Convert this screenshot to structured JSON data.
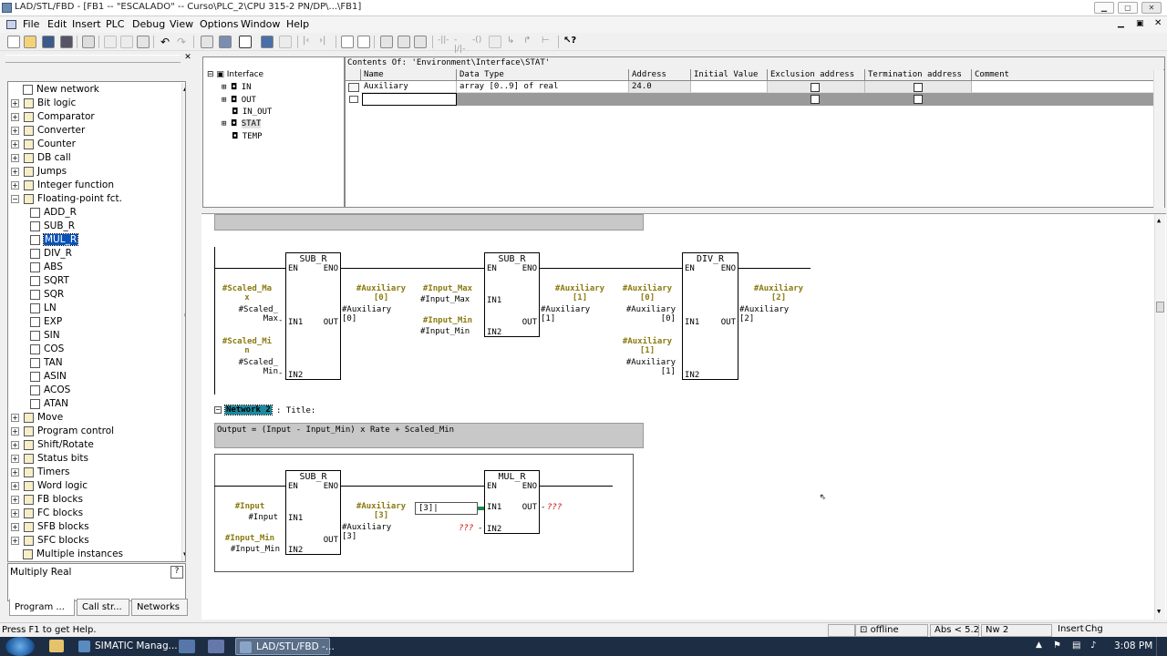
{
  "window": {
    "title": "LAD/STL/FBD  - [FB1 -- \"ESCALADO\" -- Curso\\PLC_2\\CPU 315-2 PN/DP\\...\\FB1]"
  },
  "menu": [
    "File",
    "Edit",
    "Insert",
    "PLC",
    "Debug",
    "View",
    "Options",
    "Window",
    "Help"
  ],
  "catalog": {
    "items": [
      {
        "label": "New network",
        "expander": "",
        "level": 0
      },
      {
        "label": "Bit logic",
        "expander": "+",
        "level": 0
      },
      {
        "label": "Comparator",
        "expander": "+",
        "level": 0
      },
      {
        "label": "Converter",
        "expander": "+",
        "level": 0
      },
      {
        "label": "Counter",
        "expander": "+",
        "level": 0
      },
      {
        "label": "DB call",
        "expander": "+",
        "level": 0
      },
      {
        "label": "Jumps",
        "expander": "+",
        "level": 0
      },
      {
        "label": "Integer function",
        "expander": "+",
        "level": 0
      },
      {
        "label": "Floating-point fct.",
        "expander": "-",
        "level": 0
      },
      {
        "label": "ADD_R",
        "expander": "",
        "level": 1
      },
      {
        "label": "SUB_R",
        "expander": "",
        "level": 1
      },
      {
        "label": "MUL_R",
        "expander": "",
        "level": 1,
        "selected": true
      },
      {
        "label": "DIV_R",
        "expander": "",
        "level": 1
      },
      {
        "label": "ABS",
        "expander": "",
        "level": 1
      },
      {
        "label": "SQRT",
        "expander": "",
        "level": 1
      },
      {
        "label": "SQR",
        "expander": "",
        "level": 1
      },
      {
        "label": "LN",
        "expander": "",
        "level": 1
      },
      {
        "label": "EXP",
        "expander": "",
        "level": 1
      },
      {
        "label": "SIN",
        "expander": "",
        "level": 1
      },
      {
        "label": "COS",
        "expander": "",
        "level": 1
      },
      {
        "label": "TAN",
        "expander": "",
        "level": 1
      },
      {
        "label": "ASIN",
        "expander": "",
        "level": 1
      },
      {
        "label": "ACOS",
        "expander": "",
        "level": 1
      },
      {
        "label": "ATAN",
        "expander": "",
        "level": 1
      },
      {
        "label": "Move",
        "expander": "+",
        "level": 0
      },
      {
        "label": "Program control",
        "expander": "+",
        "level": 0
      },
      {
        "label": "Shift/Rotate",
        "expander": "+",
        "level": 0
      },
      {
        "label": "Status bits",
        "expander": "+",
        "level": 0
      },
      {
        "label": "Timers",
        "expander": "+",
        "level": 0
      },
      {
        "label": "Word logic",
        "expander": "+",
        "level": 0
      },
      {
        "label": "FB blocks",
        "expander": "+",
        "level": 0
      },
      {
        "label": "FC blocks",
        "expander": "+",
        "level": 0
      },
      {
        "label": "SFB blocks",
        "expander": "+",
        "level": 0
      },
      {
        "label": "SFC blocks",
        "expander": "+",
        "level": 0
      },
      {
        "label": "Multiple instances",
        "expander": "",
        "level": 0
      }
    ],
    "description": "Multiply Real",
    "tabs": [
      "Program ...",
      "Call str...",
      "Networks"
    ]
  },
  "interface": {
    "root": "Interface",
    "nodes": [
      "IN",
      "OUT",
      "IN_OUT",
      "STAT",
      "TEMP"
    ],
    "caption": "Contents Of: 'Environment\\Interface\\STAT'",
    "columns": [
      "Name",
      "Data Type",
      "Address",
      "Initial Value",
      "Exclusion address",
      "Termination address",
      "Comment"
    ],
    "rows": [
      {
        "name": "Auxiliary",
        "type": "array [0..9] of real",
        "address": "24.0",
        "initial": "",
        "comment": ""
      }
    ]
  },
  "network1": {
    "boxes": [
      {
        "name": "SUB_R",
        "in1_sym": "#Scaled_Ma\nx",
        "in1_op": "#Scaled_\nMax",
        "in2_sym": "#Scaled_Mi\nn",
        "in2_op": "#Scaled_\nMin",
        "out_sym": "#Auxiliary\n[0]",
        "out_op": "#Auxiliary\n[0]"
      },
      {
        "name": "SUB_R",
        "in1_sym": "#Input_Max",
        "in1_op": "#Input_Max",
        "in2_sym": "#Input_Min",
        "in2_op": "#Input_Min",
        "out_sym": "#Auxiliary\n[1]",
        "out_op": "#Auxiliary\n[1]"
      },
      {
        "name": "DIV_R",
        "in1_sym": "#Auxiliary\n[0]",
        "in1_op": "#Auxiliary\n[0]",
        "in2_sym": "#Auxiliary\n[1]",
        "in2_op": "#Auxiliary\n[1]",
        "out_sym": "#Auxiliary\n[2]",
        "out_op": "#Auxiliary\n[2]"
      }
    ]
  },
  "network2": {
    "label": "Network 2",
    "title": ": Title:",
    "comment": "Output = (Input - Input_Min) x Rate + Scaled_Min",
    "sub": {
      "name": "SUB_R",
      "in1_sym": "#Input",
      "in1_op": "#Input",
      "in2_sym": "#Input_Min",
      "in2_op": "#Input_Min",
      "out_sym": "#Auxiliary\n[3]",
      "out_op": "#Auxiliary\n[3]"
    },
    "mul": {
      "name": "MUL_R",
      "in1_edit": "[3]",
      "in2": "???",
      "out": "???"
    }
  },
  "pins": {
    "en": "EN",
    "eno": "ENO",
    "in1": "IN1",
    "in2": "IN2",
    "out": "OUT"
  },
  "status": {
    "help": "Press F1 to get Help.",
    "mode": "offline",
    "abs": "Abs < 5.2",
    "network": "Nw 2",
    "insert": "Insert",
    "chg": "Chg"
  },
  "taskbar": {
    "items": [
      "SIMATIC Manag...",
      "LAD/STL/FBD  -..."
    ],
    "time": "3:08 PM"
  }
}
